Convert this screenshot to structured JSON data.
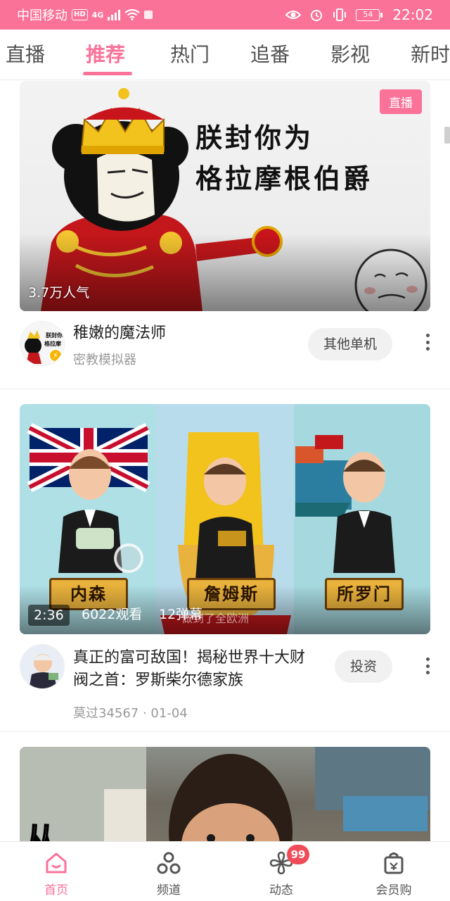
{
  "status_bar": {
    "carrier": "中国移动",
    "hd": "HD",
    "network": "4G",
    "battery": "54",
    "time": "22:02"
  },
  "tabs": {
    "items": [
      {
        "label": "直播"
      },
      {
        "label": "推荐"
      },
      {
        "label": "热门"
      },
      {
        "label": "追番"
      },
      {
        "label": "影视"
      },
      {
        "label": "新时"
      }
    ],
    "active_index": 1
  },
  "feed": {
    "cards": [
      {
        "type": "live",
        "live_badge": "直播",
        "popularity": "3.7万人气",
        "cover_text_line1": "朕封你为",
        "cover_text_line2": "格拉摩根伯爵",
        "title": "稚嫩的魔法师",
        "subtitle": "密教模拟器",
        "tag_button": "其他单机",
        "avatar_text": "朕封你为格拉摩根伯爵"
      },
      {
        "type": "video",
        "duration": "2:36",
        "views": "6022观看",
        "danmaku": "12弹幕",
        "subtitle_overlay": "做到了全欧洲",
        "nameplates": [
          "内森",
          "詹姆斯",
          "所罗门"
        ],
        "title": "真正的富可敌国！揭秘世界十大财阀之首：罗斯柴尔德家族",
        "meta": "莫过34567 · 01-04",
        "tag_button": "投资"
      },
      {
        "type": "video",
        "cover_text": "从"
      }
    ]
  },
  "bottom_nav": {
    "items": [
      {
        "label": "首页",
        "icon": "home-icon",
        "active": true
      },
      {
        "label": "频道",
        "icon": "channel-icon",
        "active": false
      },
      {
        "label": "动态",
        "icon": "fan-icon",
        "active": false,
        "badge": "99"
      },
      {
        "label": "会员购",
        "icon": "shopping-bag-icon",
        "active": false
      }
    ]
  },
  "colors": {
    "accent": "#fb7299",
    "badge": "#f04b59"
  }
}
